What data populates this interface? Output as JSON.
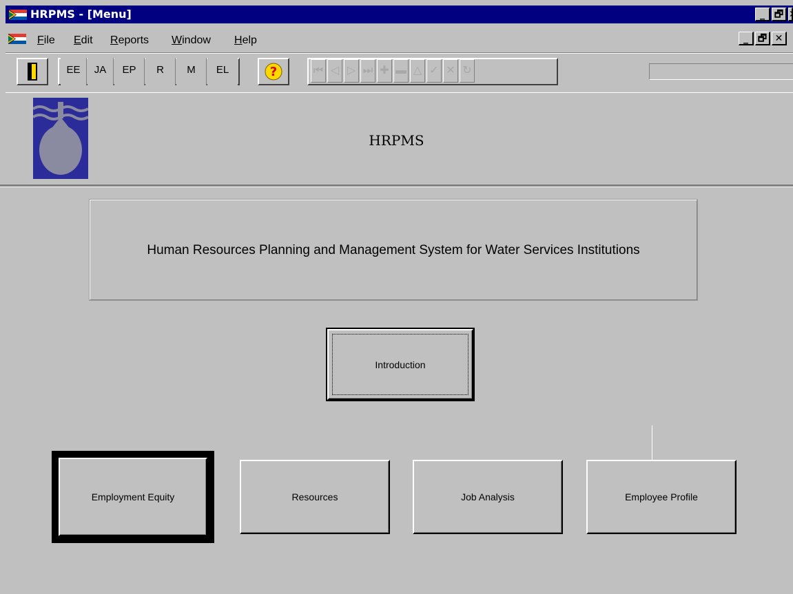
{
  "window": {
    "title": "HRPMS - [Menu]",
    "title_buttons": [
      "_",
      "🗗",
      "✕"
    ]
  },
  "menu": {
    "items": [
      {
        "label": "File",
        "underline": "F",
        "rest": "ile"
      },
      {
        "label": "Edit",
        "underline": "E",
        "rest": "dit"
      },
      {
        "label": "Reports",
        "underline": "R",
        "rest": "eports"
      },
      {
        "label": "Window",
        "underline": "W",
        "rest": "indow"
      },
      {
        "label": "Help",
        "underline": "H",
        "rest": "elp"
      }
    ]
  },
  "toolbar": {
    "module_buttons": [
      "EE",
      "JA",
      "EP",
      "R",
      "M",
      "EL"
    ],
    "help_icon": "?",
    "nav_buttons": [
      {
        "icon": "first-record-icon",
        "glyph": "⏮"
      },
      {
        "icon": "previous-record-icon",
        "glyph": "◁"
      },
      {
        "icon": "next-record-icon",
        "glyph": "▷"
      },
      {
        "icon": "last-record-icon",
        "glyph": "⏭"
      },
      {
        "icon": "add-record-icon",
        "glyph": "✚"
      },
      {
        "icon": "delete-record-icon",
        "glyph": "▬"
      },
      {
        "icon": "up-icon",
        "glyph": "△"
      },
      {
        "icon": "save-check-icon",
        "glyph": "✓"
      },
      {
        "icon": "cancel-x-icon",
        "glyph": "✕"
      },
      {
        "icon": "refresh-icon",
        "glyph": "↻"
      }
    ],
    "search_value": ""
  },
  "header": {
    "heading": "HRPMS",
    "logo_icon": "water-drop-logo"
  },
  "system_title": "Human Resources Planning and Management System for Water Services Institutions",
  "buttons": {
    "introduction": "Introduction",
    "employment_equity": "Employment Equity",
    "resources": "Resources",
    "job_analysis": "Job Analysis",
    "employee_profile": "Employee Profile"
  },
  "colors": {
    "title_bar": "#000080",
    "face": "#c0c0c0",
    "logo_bg": "#2b2b9a",
    "logo_drop": "#8a8aa0"
  }
}
